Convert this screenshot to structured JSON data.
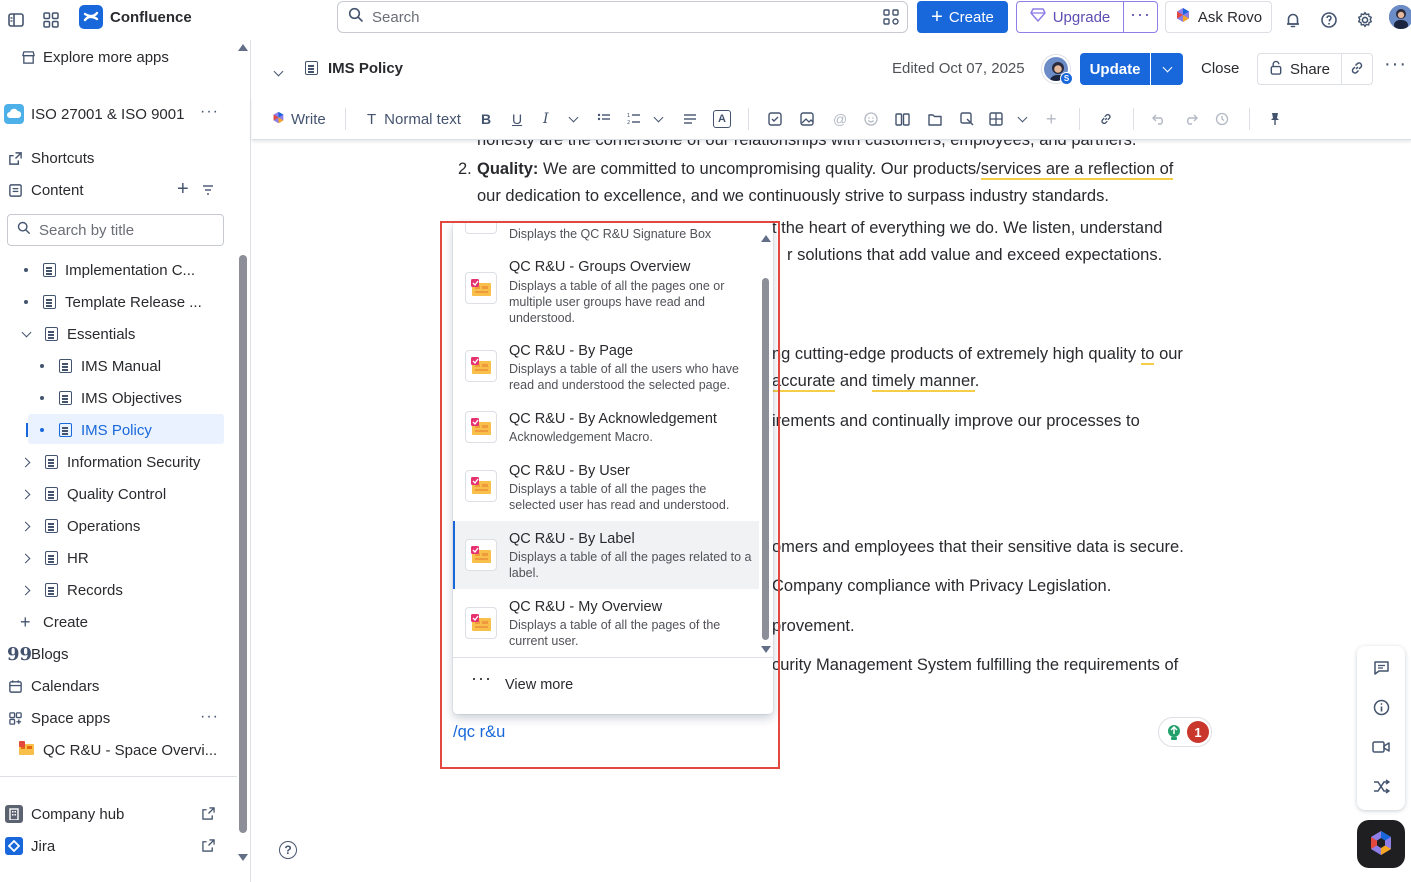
{
  "topbar": {
    "app_name": "Confluence",
    "search_placeholder": "Search",
    "create_label": "Create",
    "upgrade_label": "Upgrade",
    "ask_rovo_label": "Ask Rovo"
  },
  "sidebar": {
    "explore_label": "Explore more apps",
    "space_name": "ISO 27001 & ISO 9001",
    "shortcuts_label": "Shortcuts",
    "content_label": "Content",
    "search_placeholder": "Search by title",
    "tree": [
      {
        "label": "Implementation C...",
        "level": 1,
        "expander": "dot"
      },
      {
        "label": "Template Release ...",
        "level": 1,
        "expander": "dot"
      },
      {
        "label": "Essentials",
        "level": 1,
        "expander": "open"
      },
      {
        "label": "IMS Manual",
        "level": 2,
        "expander": "dot"
      },
      {
        "label": "IMS Objectives",
        "level": 2,
        "expander": "dot"
      },
      {
        "label": "IMS Policy",
        "level": 2,
        "expander": "dot",
        "active": true
      },
      {
        "label": "Information Security",
        "level": 1,
        "expander": "closed"
      },
      {
        "label": "Quality Control",
        "level": 1,
        "expander": "closed"
      },
      {
        "label": "Operations",
        "level": 1,
        "expander": "closed"
      },
      {
        "label": "HR",
        "level": 1,
        "expander": "closed"
      },
      {
        "label": "Records",
        "level": 1,
        "expander": "closed"
      }
    ],
    "create_label": "Create",
    "blogs_label": "Blogs",
    "calendars_label": "Calendars",
    "space_apps_label": "Space apps",
    "space_app_item": "QC R&U - Space Overvi...",
    "company_hub_label": "Company hub",
    "jira_label": "Jira"
  },
  "page": {
    "title": "IMS Policy",
    "edited": "Edited Oct 07, 2025",
    "update_label": "Update",
    "close_label": "Close",
    "share_label": "Share"
  },
  "toolbar": {
    "write_label": "Write",
    "text_style_label": "Normal text"
  },
  "content": {
    "line_top_cut": "honesty are the cornerstone of our relationships with customers, employees, and partners.",
    "item2_num": "2.",
    "item2_bold": "Quality:",
    "item2_text_a": " We are committed to uncompromising quality. Our products/",
    "item2_text_b": "services are a reflection of",
    "item2_line2": "our dedication to excellence, and we continuously strive to surpass industry standards.",
    "item3_right1": "t the heart of everything we do. We listen, understand",
    "item3_right2": "r solutions that add value and exceed expectations.",
    "p1_right1_a": "ng cutting-edge products of extremely high quality ",
    "p1_right1_to": "to",
    "p1_right1_b": " our",
    "p1_right2_accurate": "accurate",
    "p1_right2_and": " and ",
    "p1_right2_timely": "timely manner",
    "p1_right2_end": ".",
    "p2_right": "irements and continually improve our processes to",
    "p3_right": "omers and employees that their sensitive data is secure.",
    "p4_right": "Company compliance with Privacy Legislation.",
    "p5_right": "provement.",
    "p6_right": "curity Management System fulfilling the requirements of",
    "slash_command": "/qc r&u"
  },
  "slash_menu": {
    "partial_top_desc": "Displays the QC R&U Signature Box",
    "items": [
      {
        "title": "QC R&U - Groups Overview",
        "desc": "Displays a table of all the pages one or multiple user groups have read and understood."
      },
      {
        "title": "QC R&U - By Page",
        "desc": "Displays a table of all the users who have read and understood the selected page."
      },
      {
        "title": "QC R&U - By Acknowledgement",
        "desc": "Acknowledgement Macro."
      },
      {
        "title": "QC R&U - By User",
        "desc": "Displays a table of all the pages the selected user has read and understood."
      },
      {
        "title": "QC R&U - By Label",
        "desc": "Displays a table of all the pages related to a label.",
        "selected": true
      },
      {
        "title": "QC R&U - My Overview",
        "desc": "Displays a table of all the pages of the current user."
      }
    ],
    "view_more_label": "View more"
  },
  "notification": {
    "count": "1"
  },
  "colors": {
    "brand_blue": "#1868DB",
    "upgrade_purple": "#5E4DB2",
    "highlight_red": "#E2483D",
    "underline_yellow": "#F5CD47",
    "selected_bg": "#F1F2F4",
    "sidebar_active_bg": "#E9F2FE"
  },
  "icons": [
    "sidebar-toggle-icon",
    "app-switcher-icon",
    "confluence-logo-icon",
    "search-icon",
    "filter-icon",
    "plus-icon",
    "gem-icon",
    "more-icon",
    "rovo-icon",
    "bell-icon",
    "help-icon",
    "gear-icon",
    "avatar"
  ]
}
